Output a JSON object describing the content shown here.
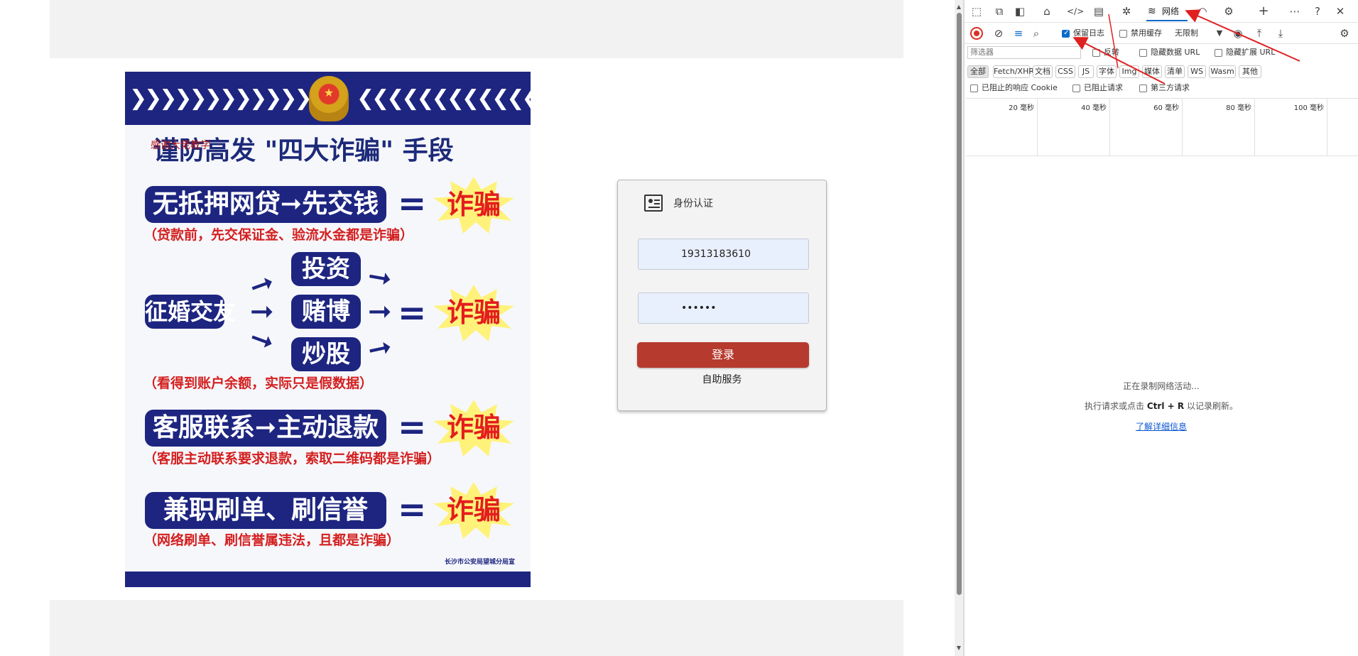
{
  "poster": {
    "title": "谨防高发 \"四大诈骗\" 手段",
    "overlay_text": "感谢大佬教学",
    "scam1": "无抵押网贷➞先交钱",
    "scam1_note": "（贷款前，先交保证金、验流水金都是诈骗）",
    "scam2_left": "征婚交友",
    "scam2_items": [
      "投资",
      "赌博",
      "炒股"
    ],
    "scam2_note": "（看得到账户余额，实际只是假数据）",
    "scam3": "客服联系➞主动退款",
    "scam3_note": "（客服主动联系要求退款，索取二维码都是诈骗）",
    "scam4": "兼职刷单、刷信誉",
    "scam4_note": "（网络刷单、刷信誉属违法，且都是诈骗）",
    "equals": "=",
    "fraud_word": "诈骗",
    "footer": "长沙市公安局望城分局宣"
  },
  "login": {
    "title": "身份认证",
    "username": "19313183610",
    "password": "••••••",
    "login_button": "登录",
    "self_service": "自助服务"
  },
  "devtools": {
    "tab_network": "网络",
    "preserve_log": "保留日志",
    "preserve_log_checked": true,
    "disable_cache": "禁用缓存",
    "throttling": "无限制",
    "filter_placeholder": "筛选器",
    "invert": "反转",
    "hide_data_urls": "隐藏数据 URL",
    "hide_extension_urls": "隐藏扩展 URL",
    "types": [
      "全部",
      "Fetch/XHR",
      "文档",
      "CSS",
      "JS",
      "字体",
      "Img",
      "媒体",
      "清单",
      "WS",
      "Wasm",
      "其他"
    ],
    "blocked_cookies": "已阻止的响应 Cookie",
    "blocked_requests": "已阻止请求",
    "third_party": "第三方请求",
    "timeline_labels": [
      "20 毫秒",
      "40 毫秒",
      "60 毫秒",
      "80 毫秒",
      "100 毫秒"
    ],
    "recording_msg": "正在录制网络活动...",
    "hint_prefix": "执行请求或点击",
    "hint_shortcut": "Ctrl + R",
    "hint_suffix": "以记录刷新。",
    "learn_more": "了解详细信息",
    "accent_color": "#0b6bcb"
  },
  "colors": {
    "poster_navy": "#1d2580",
    "fraud_red": "#e41d1d",
    "login_button": "#b73a2e",
    "annotation_red": "#e02020"
  }
}
